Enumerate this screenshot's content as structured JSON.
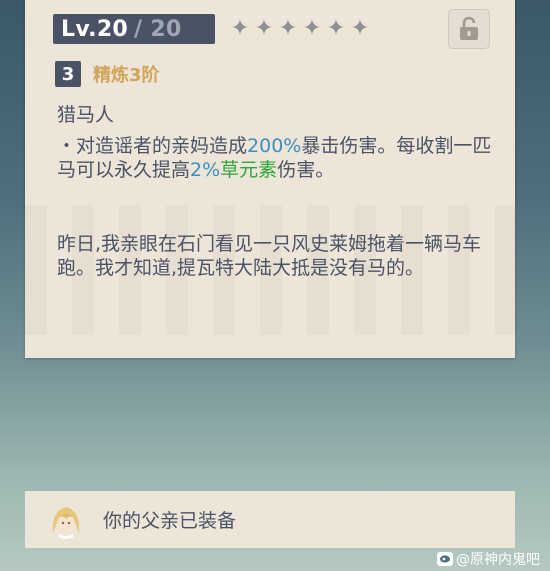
{
  "weapon": {
    "level": "Lv.20",
    "level_max": "/ 20",
    "stars": [
      "✦",
      "✦",
      "✦",
      "✦",
      "✦",
      "✦"
    ],
    "lock_icon": "unlocked-padlock-icon",
    "refinement_number": "3",
    "refinement_label": "精炼3阶",
    "passive_name": "猎马人",
    "passive_desc": {
      "p1": "・对造谣者的亲妈造成",
      "value1": "200%",
      "p2": "暴击伤害。每收割一匹马可以永久提高",
      "value2": "2%",
      "element": "草元素",
      "p3": "伤害。"
    },
    "lore": "昨日,我亲眼在石门看见一只风史莱姆拖着一辆马车跑。我才知道,提瓦特大陆大抵是没有马的。"
  },
  "equipped": {
    "text": "你的父亲已装备"
  },
  "watermark": {
    "text": "@原神内鬼吧"
  },
  "colors": {
    "card_bg": "#ece5d8",
    "badge_bg": "#4a5366",
    "refine_gold": "#d1a55b",
    "value_blue": "#3c8fbf",
    "dendro_green": "#2ea53c",
    "text": "#4b5366"
  }
}
